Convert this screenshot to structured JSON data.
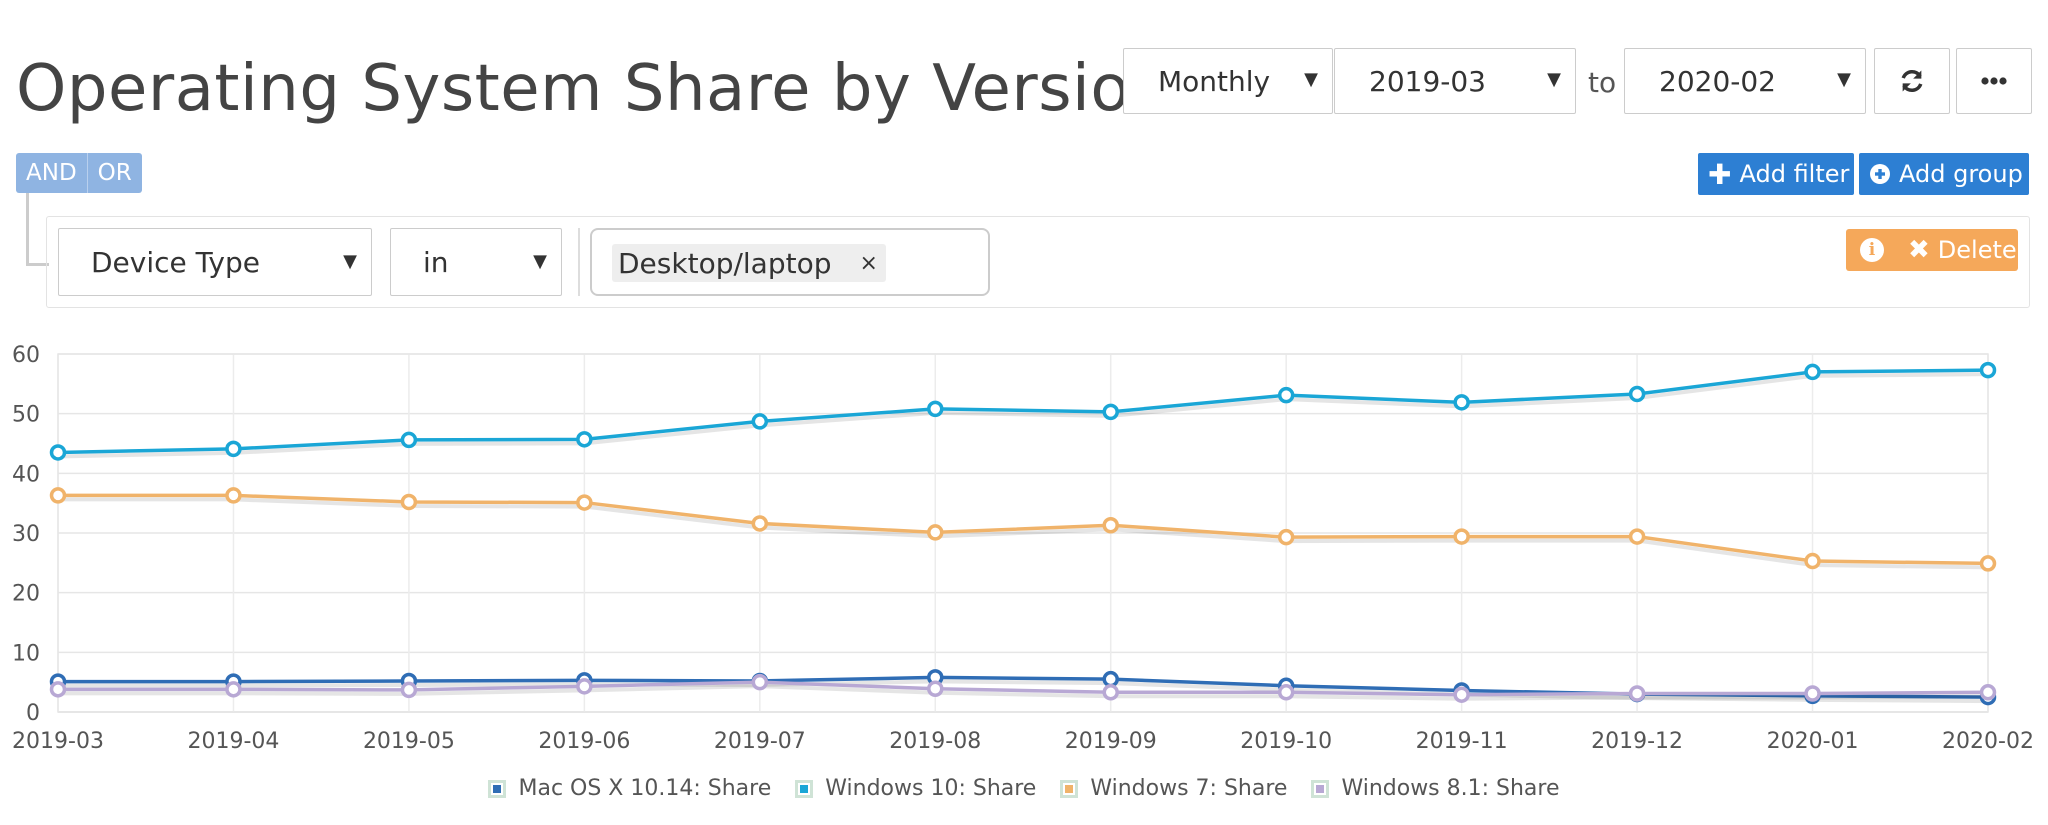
{
  "header": {
    "title": "Operating System Share by Version",
    "interval": "Monthly",
    "from": "2019-03",
    "to_label": "to",
    "to": "2020-02",
    "refresh_icon": "refresh-icon",
    "more_icon": "ellipsis-icon"
  },
  "logic": {
    "and_label": "AND",
    "or_label": "OR"
  },
  "actions": {
    "add_filter": "Add filter",
    "add_group": "Add group"
  },
  "filter": {
    "field": "Device Type",
    "operator": "in",
    "value_chip": "Desktop/laptop",
    "chip_remove": "×",
    "delete_label": "Delete",
    "info_icon": "i"
  },
  "chart_data": {
    "type": "line",
    "x": [
      "2019-03",
      "2019-04",
      "2019-05",
      "2019-06",
      "2019-07",
      "2019-08",
      "2019-09",
      "2019-10",
      "2019-11",
      "2019-12",
      "2020-01",
      "2020-02"
    ],
    "ylim": [
      0,
      60
    ],
    "yticks": [
      0,
      10,
      20,
      30,
      40,
      50,
      60
    ],
    "grid": true,
    "legend": "bottom",
    "series": [
      {
        "name": "Mac OS X 10.14: Share",
        "color": "#2f6db5",
        "values": [
          5.1,
          5.1,
          5.2,
          5.3,
          5.2,
          5.8,
          5.5,
          4.4,
          3.6,
          3.0,
          2.7,
          2.5
        ]
      },
      {
        "name": "Windows 10: Share",
        "color": "#1aa6d6",
        "values": [
          43.5,
          44.1,
          45.6,
          45.7,
          48.7,
          50.8,
          50.3,
          53.1,
          51.9,
          53.3,
          57.0,
          57.3
        ]
      },
      {
        "name": "Windows 7: Share",
        "color": "#f0b36a",
        "values": [
          36.3,
          36.3,
          35.2,
          35.1,
          31.6,
          30.1,
          31.3,
          29.3,
          29.4,
          29.4,
          25.3,
          24.9
        ]
      },
      {
        "name": "Windows 8.1: Share",
        "color": "#b8a8d4",
        "values": [
          3.8,
          3.8,
          3.7,
          4.3,
          5.0,
          3.9,
          3.3,
          3.3,
          2.9,
          3.1,
          3.1,
          3.3
        ]
      }
    ]
  }
}
